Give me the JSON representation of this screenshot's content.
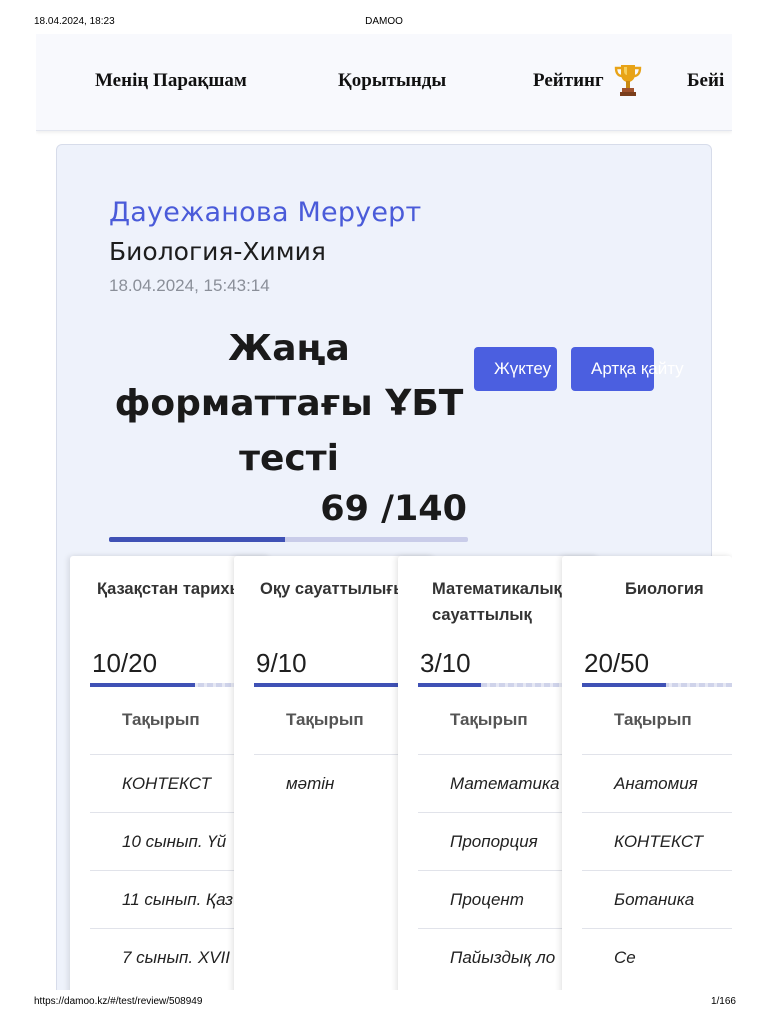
{
  "print_header": {
    "datetime": "18.04.2024, 18:23",
    "title": "DAMOO"
  },
  "print_footer": {
    "url": "https://damoo.kz/#/test/review/508949",
    "page": "1/166"
  },
  "nav": {
    "items": [
      {
        "label": "Менің Парақшам"
      },
      {
        "label": "Қорытынды"
      },
      {
        "label": "Рейтинг"
      },
      {
        "label": "Бейі"
      }
    ],
    "trophy_icon": "trophy-icon"
  },
  "result": {
    "student_name": "Дауежанова Меруерт",
    "subject_pair": "Биология-Химия",
    "datetime": "18.04.2024, 15:43:14",
    "test_title": "Жаңа форматтағы ҰБТ тесті",
    "score": "69 /140",
    "progress": 0.49,
    "download_label": "Жүктеу",
    "back_label": "Артқа қайту"
  },
  "subjects": [
    {
      "title": "Қазақстан тарихы",
      "score": "10/20",
      "progress": 0.5,
      "topic_header": "Тақырып",
      "topics": [
        "КОНТЕКСТ",
        "10 сынып. Үй",
        "11 сынып. Қаз",
        "7 сынып. XVII"
      ]
    },
    {
      "title": "Оқу сауаттылығы",
      "score": "9/10",
      "progress": 0.9,
      "topic_header": "Тақырып",
      "topics": [
        "мәтін"
      ]
    },
    {
      "title": "Математикалық сауаттылық",
      "score": "3/10",
      "progress": 0.3,
      "topic_header": "Тақырып",
      "topics": [
        "Математика",
        "Пропорция",
        "Процент",
        "Пайыздық ло"
      ]
    },
    {
      "title": "Биология",
      "score": "20/50",
      "progress": 0.4,
      "topic_header": "Тақырып",
      "topics": [
        "Анатомия",
        "КОНТЕКСТ",
        "Ботаника",
        "Се"
      ]
    }
  ],
  "scroll_top_icon": "arrow-up-icon",
  "colors": {
    "accent": "#4b5fe0",
    "bar": "#3f51b5",
    "name": "#4a5bd9"
  }
}
